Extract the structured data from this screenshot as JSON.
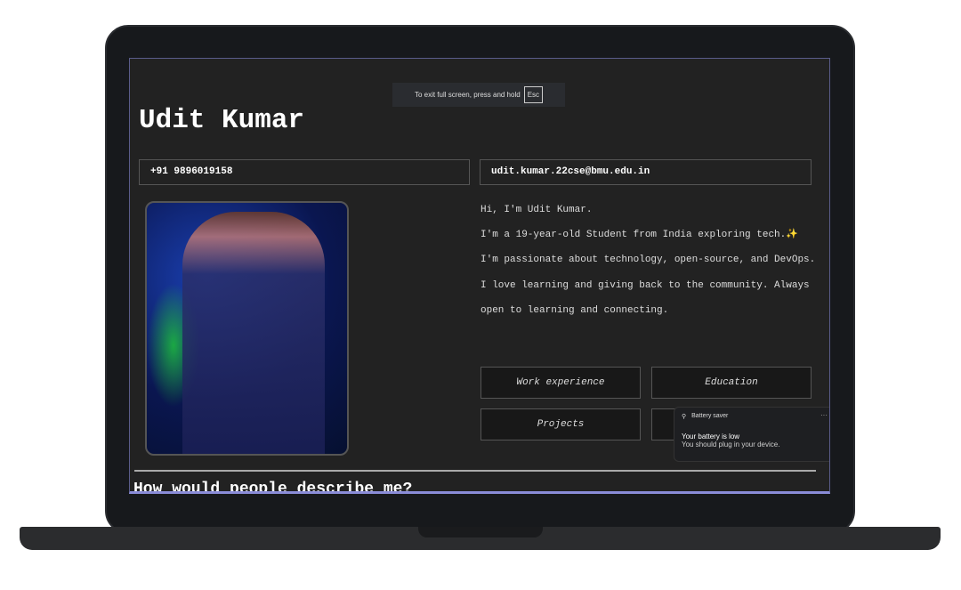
{
  "fullscreen": {
    "message": "To exit full screen, press and hold",
    "key": "Esc"
  },
  "profile": {
    "name": "Udit Kumar",
    "phone": "+91 9896019158",
    "email": "udit.kumar.22cse@bmu.edu.in"
  },
  "bio": {
    "greeting": "Hi, I'm Udit Kumar.",
    "text": "I'm a 19-year-old Student from India exploring tech.✨ I'm passionate about technology, open-source, and DevOps. I love learning and giving back to the community. Always open to learning and connecting."
  },
  "buttons": [
    "Work experience",
    "Education",
    "Projects",
    ""
  ],
  "section_heading": "How would people describe me?",
  "toast": {
    "app": "Battery saver",
    "title": "Your battery is low",
    "body": "You should plug in your device.",
    "menu": "···"
  }
}
